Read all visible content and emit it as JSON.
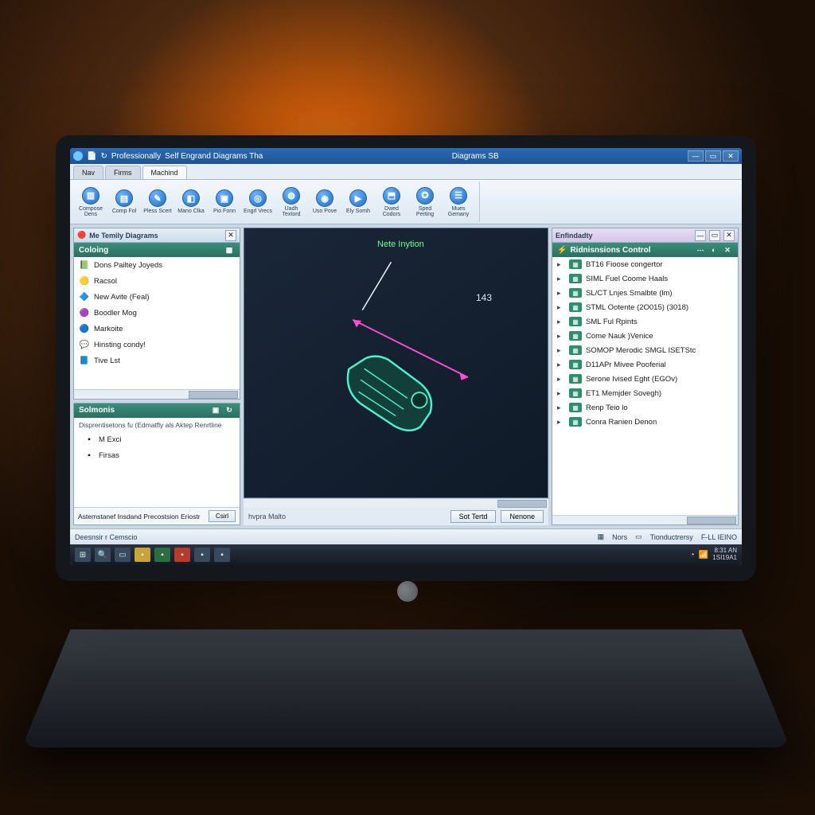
{
  "titlebar": {
    "app_left1": "Professionally",
    "app_left2": "Self Engrand Diagrams Tha",
    "app_center": "Diagrams SB"
  },
  "tabs": [
    {
      "label": "Nav"
    },
    {
      "label": "Firms"
    },
    {
      "label": "Machind"
    }
  ],
  "ribbon": [
    {
      "label": "Compose Dens",
      "glyph": "▥"
    },
    {
      "label": "Comp Fol",
      "glyph": "▤"
    },
    {
      "label": "Pless Scert",
      "glyph": "✎"
    },
    {
      "label": "Mano Clka",
      "glyph": "◧"
    },
    {
      "label": "Pio Fonn",
      "glyph": "▣"
    },
    {
      "label": "Engrl Vrecs",
      "glyph": "◎"
    },
    {
      "label": "Uadh Textord",
      "glyph": "◍"
    },
    {
      "label": "Uso Pove",
      "glyph": "◉"
    },
    {
      "label": "Ely Somh",
      "glyph": "▶"
    },
    {
      "label": "Dwed Codors",
      "glyph": "⬒"
    },
    {
      "label": "Sped Perting",
      "glyph": "✪"
    },
    {
      "label": "Mues Gemany",
      "glyph": "☰"
    }
  ],
  "left_panel": {
    "title": "Me Temily Diagrams",
    "section": "Coloing",
    "items": [
      {
        "icon": "📗",
        "label": "Dons Pailtey Joyeds"
      },
      {
        "icon": "🟡",
        "label": "Racsol"
      },
      {
        "icon": "🔷",
        "label": "New Avite (Feal)"
      },
      {
        "icon": "🟣",
        "label": "Boodler Mog"
      },
      {
        "icon": "🔵",
        "label": "Markoite"
      },
      {
        "icon": "💬",
        "label": "Hinsting condy!"
      },
      {
        "icon": "📘",
        "label": "Tive Lst"
      }
    ]
  },
  "solmon_panel": {
    "title": "Solmonis",
    "desc": "Disprentisetons fu (Edmatfly als Aktep Renrtline",
    "items": [
      {
        "label": "M Exci"
      },
      {
        "label": "Firsas"
      }
    ],
    "footer_text": "Astemstanef Insdand Precostsion Eriostr",
    "footer_btn": "Csirl"
  },
  "viewport": {
    "label": "Nete Inytion",
    "dim": "143"
  },
  "center_footer": {
    "label": "hvpra Malto",
    "btn1": "Sot Tertd",
    "btn2": "Nenone"
  },
  "right_panel": {
    "title": "Enfindadty",
    "section": "Ridnisnsions Control",
    "items": [
      {
        "label": "BT16 Fioose congertor"
      },
      {
        "label": "SIML Fuel Coome Haals"
      },
      {
        "label": "SL/CT Lnjes Smalbte (lm)"
      },
      {
        "label": "STML Ootente (2O015) (3018)"
      },
      {
        "label": "SML Ful Rpints"
      },
      {
        "label": "Come Nauk )Venice"
      },
      {
        "label": "SOMOP Merodic SMGL ISETStc"
      },
      {
        "label": "D11APr Mivee Pooferial"
      },
      {
        "label": "Serone Ivised Eght (EGOv)"
      },
      {
        "label": "ET1 Memjder Sovegh)"
      },
      {
        "label": "Renp Teio lo"
      },
      {
        "label": "Conra Ranien Denon"
      }
    ]
  },
  "statusbar": {
    "left": "Deesnsir r Cemscio",
    "mid1": "Nors",
    "mid2": "Tionductrersy",
    "right": "F-LL IEINO"
  },
  "taskbar": {
    "time1": "8:31 AN",
    "time2": "1SI19A1"
  }
}
